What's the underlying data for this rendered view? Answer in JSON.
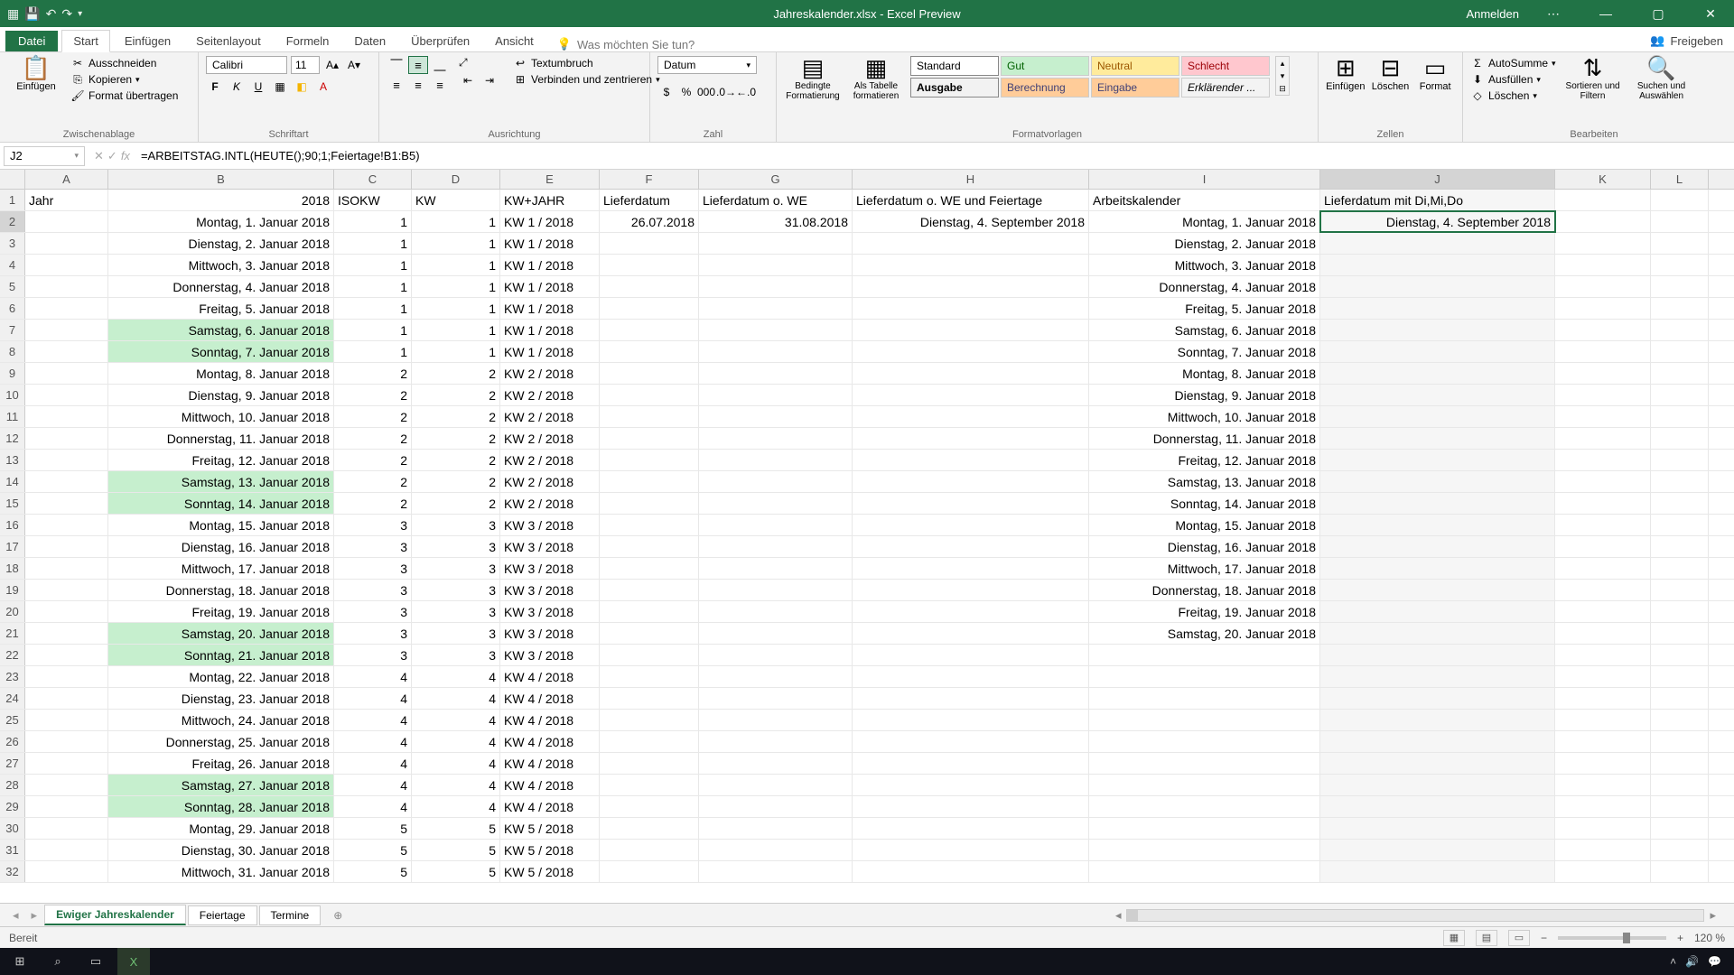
{
  "window": {
    "title": "Jahreskalender.xlsx - Excel Preview",
    "signin": "Anmelden"
  },
  "tabs": {
    "file": "Datei",
    "items": [
      "Start",
      "Einfügen",
      "Seitenlayout",
      "Formeln",
      "Daten",
      "Überprüfen",
      "Ansicht"
    ],
    "active": "Start",
    "tellme": "Was möchten Sie tun?",
    "share": "Freigeben"
  },
  "ribbon": {
    "clipboard": {
      "paste": "Einfügen",
      "cut": "Ausschneiden",
      "copy": "Kopieren",
      "format_painter": "Format übertragen",
      "label": "Zwischenablage"
    },
    "font": {
      "name": "Calibri",
      "size": "11",
      "label": "Schriftart"
    },
    "alignment": {
      "wrap": "Textumbruch",
      "merge": "Verbinden und zentrieren",
      "label": "Ausrichtung"
    },
    "number": {
      "format": "Datum",
      "label": "Zahl"
    },
    "styles": {
      "cond": "Bedingte Formatierung",
      "table": "Als Tabelle formatieren",
      "cells_label": "Formatvorlagen",
      "items": [
        "Standard",
        "Gut",
        "Neutral",
        "Schlecht",
        "Ausgabe",
        "Berechnung",
        "Eingabe",
        "Erklärender ..."
      ]
    },
    "cells": {
      "insert": "Einfügen",
      "delete": "Löschen",
      "format": "Format",
      "label": "Zellen"
    },
    "editing": {
      "autosum": "AutoSumme",
      "fill": "Ausfüllen",
      "clear": "Löschen",
      "sort": "Sortieren und Filtern",
      "find": "Suchen und Auswählen",
      "label": "Bearbeiten"
    }
  },
  "formula_bar": {
    "name_box": "J2",
    "formula": "=ARBEITSTAG.INTL(HEUTE();90;1;Feiertage!B1:B5)"
  },
  "columns": [
    "A",
    "B",
    "C",
    "D",
    "E",
    "F",
    "G",
    "H",
    "I",
    "J",
    "K",
    "L"
  ],
  "headers": {
    "A": "Jahr",
    "B": "2018",
    "C": "ISOKW",
    "D": "KW",
    "E": "KW+JAHR",
    "F": "Lieferdatum",
    "G": "Lieferdatum o. WE",
    "H": "Lieferdatum o. WE und Feiertage",
    "I": "Arbeitskalender",
    "J": "Lieferdatum mit Di,Mi,Do"
  },
  "row2": {
    "F": "26.07.2018",
    "G": "31.08.2018",
    "H": "Dienstag, 4. September 2018",
    "J": "Dienstag, 4. September 2018"
  },
  "days": [
    {
      "r": 2,
      "b": "Montag, 1. Januar 2018",
      "c": 1,
      "d": 1,
      "e": "KW 1 / 2018",
      "i": "Montag, 1. Januar 2018",
      "we": false
    },
    {
      "r": 3,
      "b": "Dienstag, 2. Januar 2018",
      "c": 1,
      "d": 1,
      "e": "KW 1 / 2018",
      "i": "Dienstag, 2. Januar 2018",
      "we": false
    },
    {
      "r": 4,
      "b": "Mittwoch, 3. Januar 2018",
      "c": 1,
      "d": 1,
      "e": "KW 1 / 2018",
      "i": "Mittwoch, 3. Januar 2018",
      "we": false
    },
    {
      "r": 5,
      "b": "Donnerstag, 4. Januar 2018",
      "c": 1,
      "d": 1,
      "e": "KW 1 / 2018",
      "i": "Donnerstag, 4. Januar 2018",
      "we": false
    },
    {
      "r": 6,
      "b": "Freitag, 5. Januar 2018",
      "c": 1,
      "d": 1,
      "e": "KW 1 / 2018",
      "i": "Freitag, 5. Januar 2018",
      "we": false
    },
    {
      "r": 7,
      "b": "Samstag, 6. Januar 2018",
      "c": 1,
      "d": 1,
      "e": "KW 1 / 2018",
      "i": "Samstag, 6. Januar 2018",
      "we": true
    },
    {
      "r": 8,
      "b": "Sonntag, 7. Januar 2018",
      "c": 1,
      "d": 1,
      "e": "KW 1 / 2018",
      "i": "Sonntag, 7. Januar 2018",
      "we": true
    },
    {
      "r": 9,
      "b": "Montag, 8. Januar 2018",
      "c": 2,
      "d": 2,
      "e": "KW 2 / 2018",
      "i": "Montag, 8. Januar 2018",
      "we": false
    },
    {
      "r": 10,
      "b": "Dienstag, 9. Januar 2018",
      "c": 2,
      "d": 2,
      "e": "KW 2 / 2018",
      "i": "Dienstag, 9. Januar 2018",
      "we": false
    },
    {
      "r": 11,
      "b": "Mittwoch, 10. Januar 2018",
      "c": 2,
      "d": 2,
      "e": "KW 2 / 2018",
      "i": "Mittwoch, 10. Januar 2018",
      "we": false
    },
    {
      "r": 12,
      "b": "Donnerstag, 11. Januar 2018",
      "c": 2,
      "d": 2,
      "e": "KW 2 / 2018",
      "i": "Donnerstag, 11. Januar 2018",
      "we": false
    },
    {
      "r": 13,
      "b": "Freitag, 12. Januar 2018",
      "c": 2,
      "d": 2,
      "e": "KW 2 / 2018",
      "i": "Freitag, 12. Januar 2018",
      "we": false
    },
    {
      "r": 14,
      "b": "Samstag, 13. Januar 2018",
      "c": 2,
      "d": 2,
      "e": "KW 2 / 2018",
      "i": "Samstag, 13. Januar 2018",
      "we": true
    },
    {
      "r": 15,
      "b": "Sonntag, 14. Januar 2018",
      "c": 2,
      "d": 2,
      "e": "KW 2 / 2018",
      "i": "Sonntag, 14. Januar 2018",
      "we": true
    },
    {
      "r": 16,
      "b": "Montag, 15. Januar 2018",
      "c": 3,
      "d": 3,
      "e": "KW 3 / 2018",
      "i": "Montag, 15. Januar 2018",
      "we": false
    },
    {
      "r": 17,
      "b": "Dienstag, 16. Januar 2018",
      "c": 3,
      "d": 3,
      "e": "KW 3 / 2018",
      "i": "Dienstag, 16. Januar 2018",
      "we": false
    },
    {
      "r": 18,
      "b": "Mittwoch, 17. Januar 2018",
      "c": 3,
      "d": 3,
      "e": "KW 3 / 2018",
      "i": "Mittwoch, 17. Januar 2018",
      "we": false
    },
    {
      "r": 19,
      "b": "Donnerstag, 18. Januar 2018",
      "c": 3,
      "d": 3,
      "e": "KW 3 / 2018",
      "i": "Donnerstag, 18. Januar 2018",
      "we": false
    },
    {
      "r": 20,
      "b": "Freitag, 19. Januar 2018",
      "c": 3,
      "d": 3,
      "e": "KW 3 / 2018",
      "i": "Freitag, 19. Januar 2018",
      "we": false
    },
    {
      "r": 21,
      "b": "Samstag, 20. Januar 2018",
      "c": 3,
      "d": 3,
      "e": "KW 3 / 2018",
      "i": "Samstag, 20. Januar 2018",
      "we": true
    },
    {
      "r": 22,
      "b": "Sonntag, 21. Januar 2018",
      "c": 3,
      "d": 3,
      "e": "KW 3 / 2018",
      "i": "",
      "we": true
    },
    {
      "r": 23,
      "b": "Montag, 22. Januar 2018",
      "c": 4,
      "d": 4,
      "e": "KW 4 / 2018",
      "i": "",
      "we": false
    },
    {
      "r": 24,
      "b": "Dienstag, 23. Januar 2018",
      "c": 4,
      "d": 4,
      "e": "KW 4 / 2018",
      "i": "",
      "we": false
    },
    {
      "r": 25,
      "b": "Mittwoch, 24. Januar 2018",
      "c": 4,
      "d": 4,
      "e": "KW 4 / 2018",
      "i": "",
      "we": false
    },
    {
      "r": 26,
      "b": "Donnerstag, 25. Januar 2018",
      "c": 4,
      "d": 4,
      "e": "KW 4 / 2018",
      "i": "",
      "we": false
    },
    {
      "r": 27,
      "b": "Freitag, 26. Januar 2018",
      "c": 4,
      "d": 4,
      "e": "KW 4 / 2018",
      "i": "",
      "we": false
    },
    {
      "r": 28,
      "b": "Samstag, 27. Januar 2018",
      "c": 4,
      "d": 4,
      "e": "KW 4 / 2018",
      "i": "",
      "we": true
    },
    {
      "r": 29,
      "b": "Sonntag, 28. Januar 2018",
      "c": 4,
      "d": 4,
      "e": "KW 4 / 2018",
      "i": "",
      "we": true
    },
    {
      "r": 30,
      "b": "Montag, 29. Januar 2018",
      "c": 5,
      "d": 5,
      "e": "KW 5 / 2018",
      "i": "",
      "we": false
    },
    {
      "r": 31,
      "b": "Dienstag, 30. Januar 2018",
      "c": 5,
      "d": 5,
      "e": "KW 5 / 2018",
      "i": "",
      "we": false
    },
    {
      "r": 32,
      "b": "Mittwoch, 31. Januar 2018",
      "c": 5,
      "d": 5,
      "e": "KW 5 / 2018",
      "i": "",
      "we": false
    }
  ],
  "sheets": {
    "items": [
      "Ewiger Jahreskalender",
      "Feiertage",
      "Termine"
    ],
    "active": "Ewiger Jahreskalender"
  },
  "status": {
    "ready": "Bereit",
    "zoom": "120 %"
  }
}
